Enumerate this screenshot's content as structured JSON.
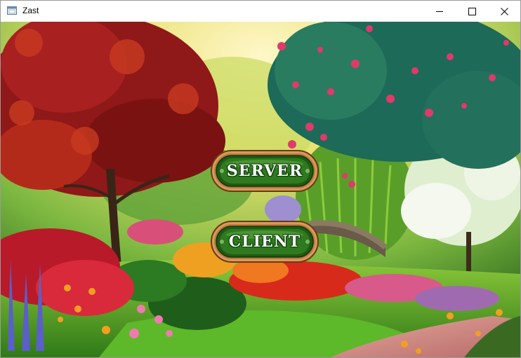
{
  "window": {
    "title": "Zast"
  },
  "title_controls": {
    "minimize_icon": "minimize-icon",
    "maximize_icon": "maximize-icon",
    "close_icon": "close-icon"
  },
  "menu": {
    "server_label": "SERVER",
    "client_label": "CLIENT"
  },
  "colors": {
    "button_green": "#2e7a1e",
    "button_rim": "#c8874a",
    "titlebar": "#ffffff"
  }
}
